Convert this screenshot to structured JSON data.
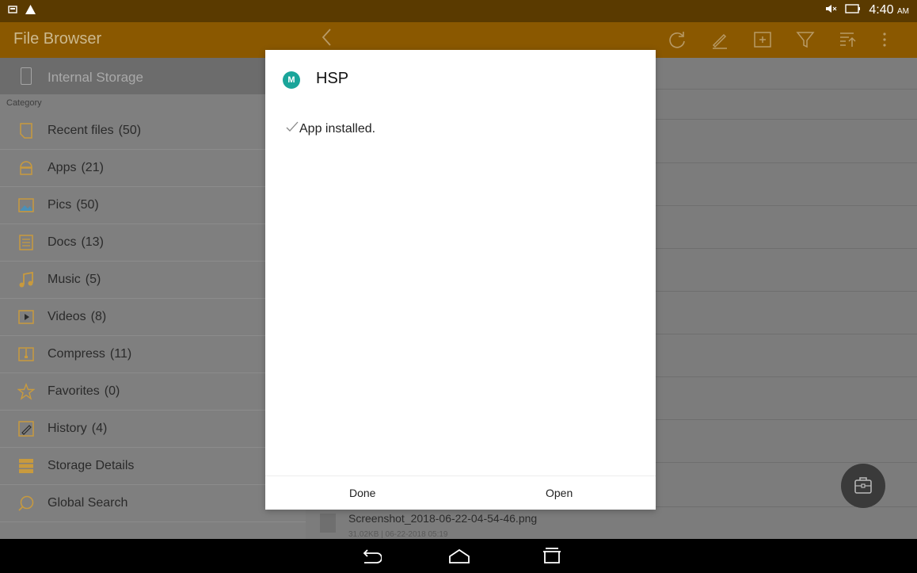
{
  "statusbar": {
    "time": "4:40",
    "ampm": "AM"
  },
  "app": {
    "title": "File Browser"
  },
  "sidebar": {
    "storage": "Internal Storage",
    "category_label": "Category",
    "items": [
      {
        "label": "Recent files",
        "count": "(50)"
      },
      {
        "label": "Apps",
        "count": "(21)"
      },
      {
        "label": "Pics",
        "count": "(50)"
      },
      {
        "label": "Docs",
        "count": "(13)"
      },
      {
        "label": "Music",
        "count": "(5)"
      },
      {
        "label": "Videos",
        "count": "(8)"
      },
      {
        "label": "Compress",
        "count": "(11)"
      },
      {
        "label": "Favorites",
        "count": "(0)"
      },
      {
        "label": "History",
        "count": "(4)"
      },
      {
        "label": "Storage Details",
        "count": ""
      },
      {
        "label": "Global Search",
        "count": ""
      }
    ]
  },
  "file_list": {
    "last_item": {
      "name": "Screenshot_2018-06-22-04-54-46.png",
      "meta": "31.02KB | 06-22-2018 05:19"
    }
  },
  "dialog": {
    "app_name": "HSP",
    "icon_text": "M",
    "message": "App installed.",
    "done_label": "Done",
    "open_label": "Open"
  },
  "colors": {
    "accent": "#8a5800",
    "status": "#5a3a00",
    "app_icon": "#1aa59a"
  }
}
